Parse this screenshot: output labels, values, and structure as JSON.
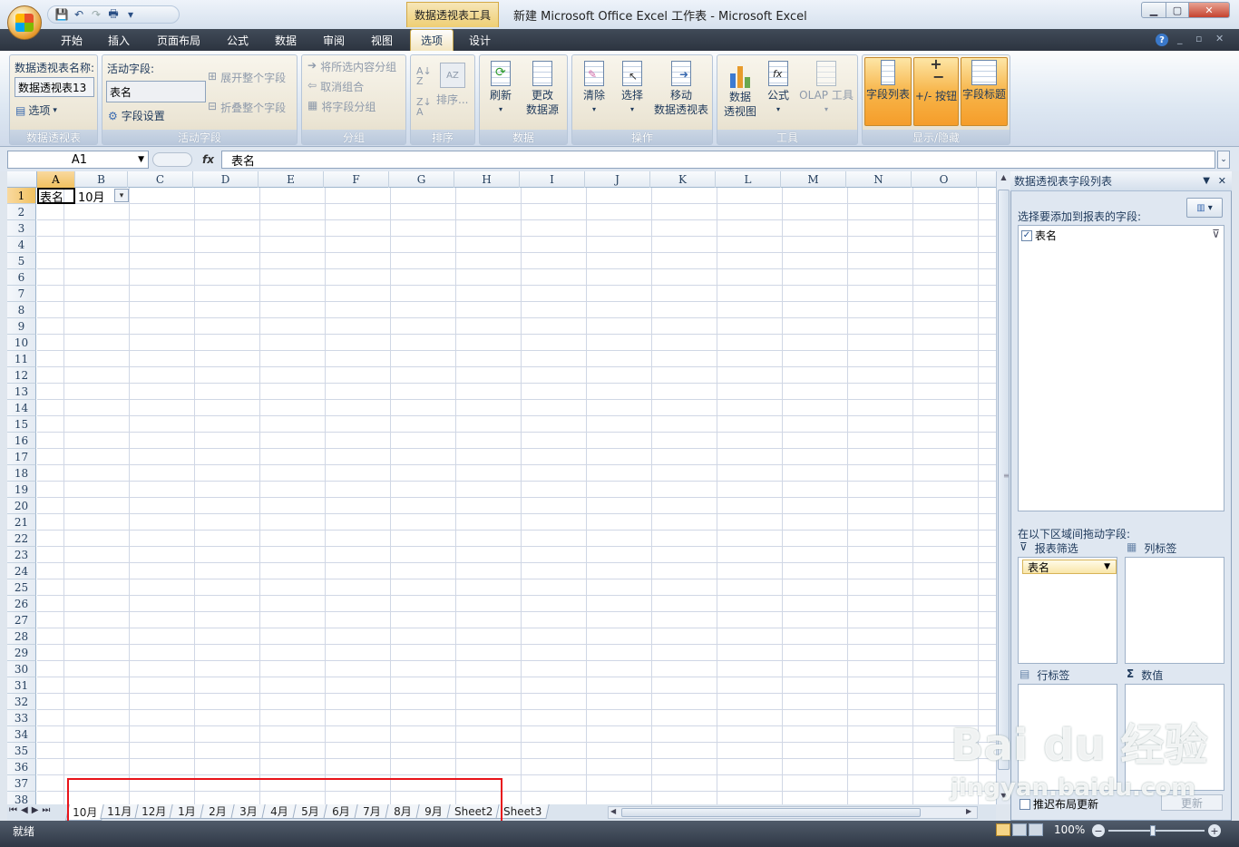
{
  "titlebar": {
    "context_tab": "数据透视表工具",
    "window_title": "新建 Microsoft Office Excel 工作表 - Microsoft Excel"
  },
  "ribbon_tabs": [
    "开始",
    "插入",
    "页面布局",
    "公式",
    "数据",
    "审阅",
    "视图",
    "选项",
    "设计"
  ],
  "active_tab": "选项",
  "groups": {
    "pivot": {
      "label": "数据透视表",
      "name_label": "数据透视表名称:",
      "name_value": "数据透视表13",
      "options": "选项"
    },
    "active_field": {
      "label": "活动字段",
      "field_label": "活动字段:",
      "field_value": "表名",
      "settings": "字段设置",
      "expand": "展开整个字段",
      "collapse": "折叠整个字段"
    },
    "group": {
      "label": "分组",
      "group_selection": "将所选内容分组",
      "ungroup": "取消组合",
      "group_field": "将字段分组"
    },
    "sort": {
      "label": "排序",
      "sort_btn": "排序..."
    },
    "data": {
      "label": "数据",
      "refresh": "刷新",
      "change_source_1": "更改",
      "change_source_2": "数据源"
    },
    "actions": {
      "label": "操作",
      "clear": "清除",
      "select": "选择",
      "move_1": "移动",
      "move_2": "数据透视表"
    },
    "tools": {
      "label": "工具",
      "pivot_chart_1": "数据",
      "pivot_chart_2": "透视图",
      "formulas": "公式",
      "olap": "OLAP 工具"
    },
    "show_hide": {
      "label": "显示/隐藏",
      "field_list": "字段列表",
      "buttons": "+/- 按钮",
      "headers": "字段标题"
    }
  },
  "formula_bar": {
    "name_box": "A1",
    "fx": "fx",
    "content": "表名"
  },
  "columns": [
    "A",
    "B",
    "C",
    "D",
    "E",
    "F",
    "G",
    "H",
    "I",
    "J",
    "K",
    "L",
    "M",
    "N",
    "O"
  ],
  "rows": [
    "1",
    "2",
    "3",
    "4",
    "5",
    "6",
    "7",
    "8",
    "9",
    "10",
    "11",
    "12",
    "13",
    "14",
    "15",
    "16",
    "17",
    "18",
    "19",
    "20",
    "21",
    "22",
    "23",
    "24",
    "25",
    "26",
    "27",
    "28",
    "29",
    "30",
    "31",
    "32",
    "33",
    "34",
    "35",
    "36",
    "37",
    "38"
  ],
  "cells": {
    "a1": "表名",
    "b1": "10月"
  },
  "sheet_tabs": [
    "10月",
    "11月",
    "12月",
    "1月",
    "2月",
    "3月",
    "4月",
    "5月",
    "6月",
    "7月",
    "8月",
    "9月",
    "Sheet2",
    "Sheet3"
  ],
  "active_sheet": "10月",
  "status": {
    "ready": "就绪",
    "zoom": "100%"
  },
  "pivot_pane": {
    "title": "数据透视表字段列表",
    "choose_label": "选择要添加到报表的字段:",
    "fields": [
      {
        "name": "表名",
        "checked": true
      }
    ],
    "drag_label": "在以下区域间拖动字段:",
    "report_filter": "报表筛选",
    "column_labels": "列标签",
    "row_labels": "行标签",
    "values": "数值",
    "filter_field": "表名",
    "defer_update": "推迟布局更新",
    "update": "更新"
  },
  "watermark": {
    "line1": "Bai du 经验",
    "line2": "jingyan.baidu.com"
  }
}
